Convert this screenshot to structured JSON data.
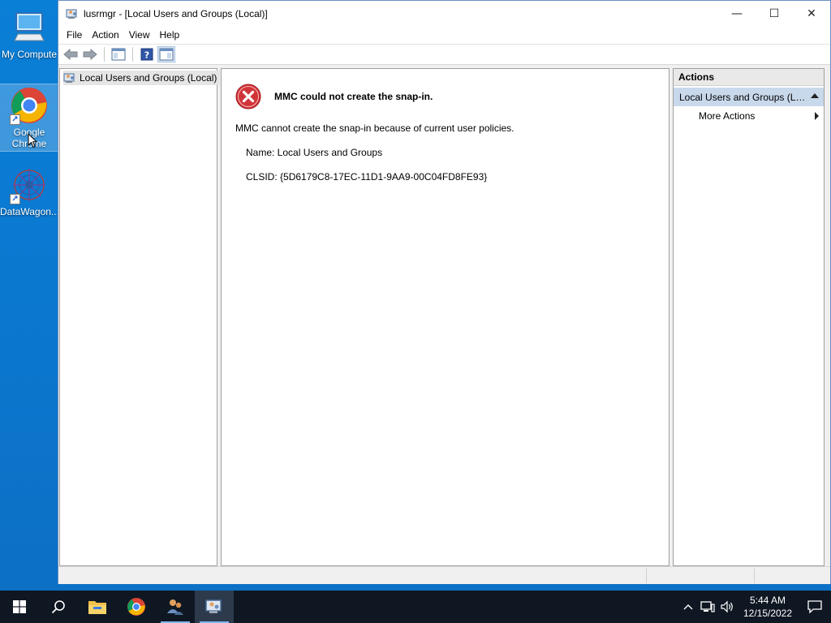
{
  "desktop": {
    "icons": [
      {
        "label": "My Compute",
        "icon": "computer-icon"
      },
      {
        "label": "Google Chrome",
        "icon": "chrome-icon"
      },
      {
        "label": "DataWagon...",
        "icon": "datawagon-icon"
      }
    ]
  },
  "window": {
    "title": "lusrmgr - [Local Users and Groups (Local)]",
    "controls": {
      "minimize": "—",
      "maximize": "☐",
      "close": "✕"
    },
    "menu": [
      "File",
      "Action",
      "View",
      "Help"
    ],
    "toolbar": [
      "back-icon",
      "forward-icon",
      "show-hide-tree-icon",
      "help-icon",
      "show-hide-action-pane-icon"
    ]
  },
  "tree": {
    "root_label": "Local Users and Groups (Local)"
  },
  "error": {
    "title": "MMC could not create the snap-in.",
    "message": "MMC cannot create the snap-in because of current user policies.",
    "name_line": "Name: Local Users and Groups",
    "clsid_line": "CLSID: {5D6179C8-17EC-11D1-9AA9-00C04FD8FE93}",
    "icon": "error-icon",
    "icon_color": "#d13438"
  },
  "actions": {
    "header": "Actions",
    "group_label": "Local Users and Groups (Lo...",
    "items": [
      {
        "label": "More Actions"
      }
    ]
  },
  "taskbar": {
    "apps": [
      "start-icon",
      "search-icon",
      "file-explorer-icon",
      "chrome-icon",
      "users-icon",
      "lusrmgr-icon"
    ],
    "time": "5:44 AM",
    "date": "12/15/2022",
    "accent": "#0f1722"
  }
}
